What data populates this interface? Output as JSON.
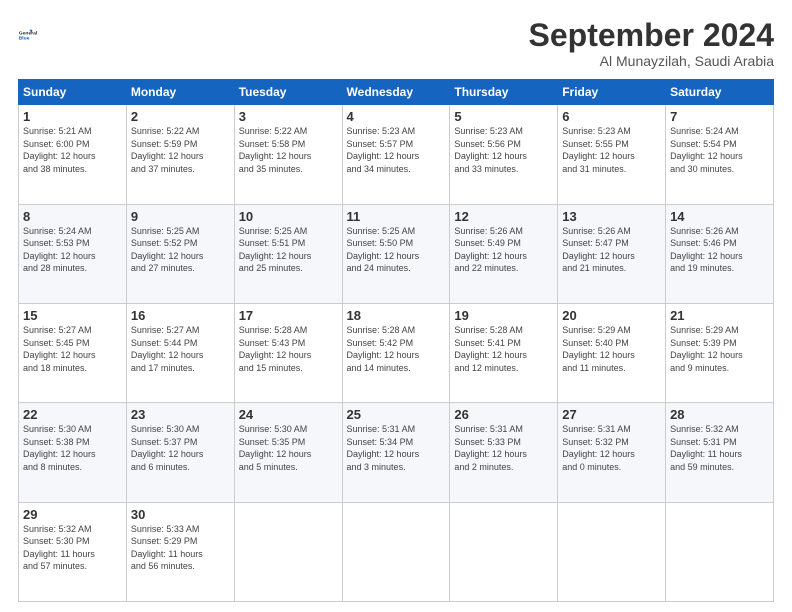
{
  "header": {
    "logo_line1": "General",
    "logo_line2": "Blue",
    "month": "September 2024",
    "location": "Al Munayzilah, Saudi Arabia"
  },
  "weekdays": [
    "Sunday",
    "Monday",
    "Tuesday",
    "Wednesday",
    "Thursday",
    "Friday",
    "Saturday"
  ],
  "weeks": [
    [
      {
        "day": "1",
        "info": "Sunrise: 5:21 AM\nSunset: 6:00 PM\nDaylight: 12 hours\nand 38 minutes."
      },
      {
        "day": "2",
        "info": "Sunrise: 5:22 AM\nSunset: 5:59 PM\nDaylight: 12 hours\nand 37 minutes."
      },
      {
        "day": "3",
        "info": "Sunrise: 5:22 AM\nSunset: 5:58 PM\nDaylight: 12 hours\nand 35 minutes."
      },
      {
        "day": "4",
        "info": "Sunrise: 5:23 AM\nSunset: 5:57 PM\nDaylight: 12 hours\nand 34 minutes."
      },
      {
        "day": "5",
        "info": "Sunrise: 5:23 AM\nSunset: 5:56 PM\nDaylight: 12 hours\nand 33 minutes."
      },
      {
        "day": "6",
        "info": "Sunrise: 5:23 AM\nSunset: 5:55 PM\nDaylight: 12 hours\nand 31 minutes."
      },
      {
        "day": "7",
        "info": "Sunrise: 5:24 AM\nSunset: 5:54 PM\nDaylight: 12 hours\nand 30 minutes."
      }
    ],
    [
      {
        "day": "8",
        "info": "Sunrise: 5:24 AM\nSunset: 5:53 PM\nDaylight: 12 hours\nand 28 minutes."
      },
      {
        "day": "9",
        "info": "Sunrise: 5:25 AM\nSunset: 5:52 PM\nDaylight: 12 hours\nand 27 minutes."
      },
      {
        "day": "10",
        "info": "Sunrise: 5:25 AM\nSunset: 5:51 PM\nDaylight: 12 hours\nand 25 minutes."
      },
      {
        "day": "11",
        "info": "Sunrise: 5:25 AM\nSunset: 5:50 PM\nDaylight: 12 hours\nand 24 minutes."
      },
      {
        "day": "12",
        "info": "Sunrise: 5:26 AM\nSunset: 5:49 PM\nDaylight: 12 hours\nand 22 minutes."
      },
      {
        "day": "13",
        "info": "Sunrise: 5:26 AM\nSunset: 5:47 PM\nDaylight: 12 hours\nand 21 minutes."
      },
      {
        "day": "14",
        "info": "Sunrise: 5:26 AM\nSunset: 5:46 PM\nDaylight: 12 hours\nand 19 minutes."
      }
    ],
    [
      {
        "day": "15",
        "info": "Sunrise: 5:27 AM\nSunset: 5:45 PM\nDaylight: 12 hours\nand 18 minutes."
      },
      {
        "day": "16",
        "info": "Sunrise: 5:27 AM\nSunset: 5:44 PM\nDaylight: 12 hours\nand 17 minutes."
      },
      {
        "day": "17",
        "info": "Sunrise: 5:28 AM\nSunset: 5:43 PM\nDaylight: 12 hours\nand 15 minutes."
      },
      {
        "day": "18",
        "info": "Sunrise: 5:28 AM\nSunset: 5:42 PM\nDaylight: 12 hours\nand 14 minutes."
      },
      {
        "day": "19",
        "info": "Sunrise: 5:28 AM\nSunset: 5:41 PM\nDaylight: 12 hours\nand 12 minutes."
      },
      {
        "day": "20",
        "info": "Sunrise: 5:29 AM\nSunset: 5:40 PM\nDaylight: 12 hours\nand 11 minutes."
      },
      {
        "day": "21",
        "info": "Sunrise: 5:29 AM\nSunset: 5:39 PM\nDaylight: 12 hours\nand 9 minutes."
      }
    ],
    [
      {
        "day": "22",
        "info": "Sunrise: 5:30 AM\nSunset: 5:38 PM\nDaylight: 12 hours\nand 8 minutes."
      },
      {
        "day": "23",
        "info": "Sunrise: 5:30 AM\nSunset: 5:37 PM\nDaylight: 12 hours\nand 6 minutes."
      },
      {
        "day": "24",
        "info": "Sunrise: 5:30 AM\nSunset: 5:35 PM\nDaylight: 12 hours\nand 5 minutes."
      },
      {
        "day": "25",
        "info": "Sunrise: 5:31 AM\nSunset: 5:34 PM\nDaylight: 12 hours\nand 3 minutes."
      },
      {
        "day": "26",
        "info": "Sunrise: 5:31 AM\nSunset: 5:33 PM\nDaylight: 12 hours\nand 2 minutes."
      },
      {
        "day": "27",
        "info": "Sunrise: 5:31 AM\nSunset: 5:32 PM\nDaylight: 12 hours\nand 0 minutes."
      },
      {
        "day": "28",
        "info": "Sunrise: 5:32 AM\nSunset: 5:31 PM\nDaylight: 11 hours\nand 59 minutes."
      }
    ],
    [
      {
        "day": "29",
        "info": "Sunrise: 5:32 AM\nSunset: 5:30 PM\nDaylight: 11 hours\nand 57 minutes."
      },
      {
        "day": "30",
        "info": "Sunrise: 5:33 AM\nSunset: 5:29 PM\nDaylight: 11 hours\nand 56 minutes."
      },
      {
        "day": "",
        "info": ""
      },
      {
        "day": "",
        "info": ""
      },
      {
        "day": "",
        "info": ""
      },
      {
        "day": "",
        "info": ""
      },
      {
        "day": "",
        "info": ""
      }
    ]
  ]
}
